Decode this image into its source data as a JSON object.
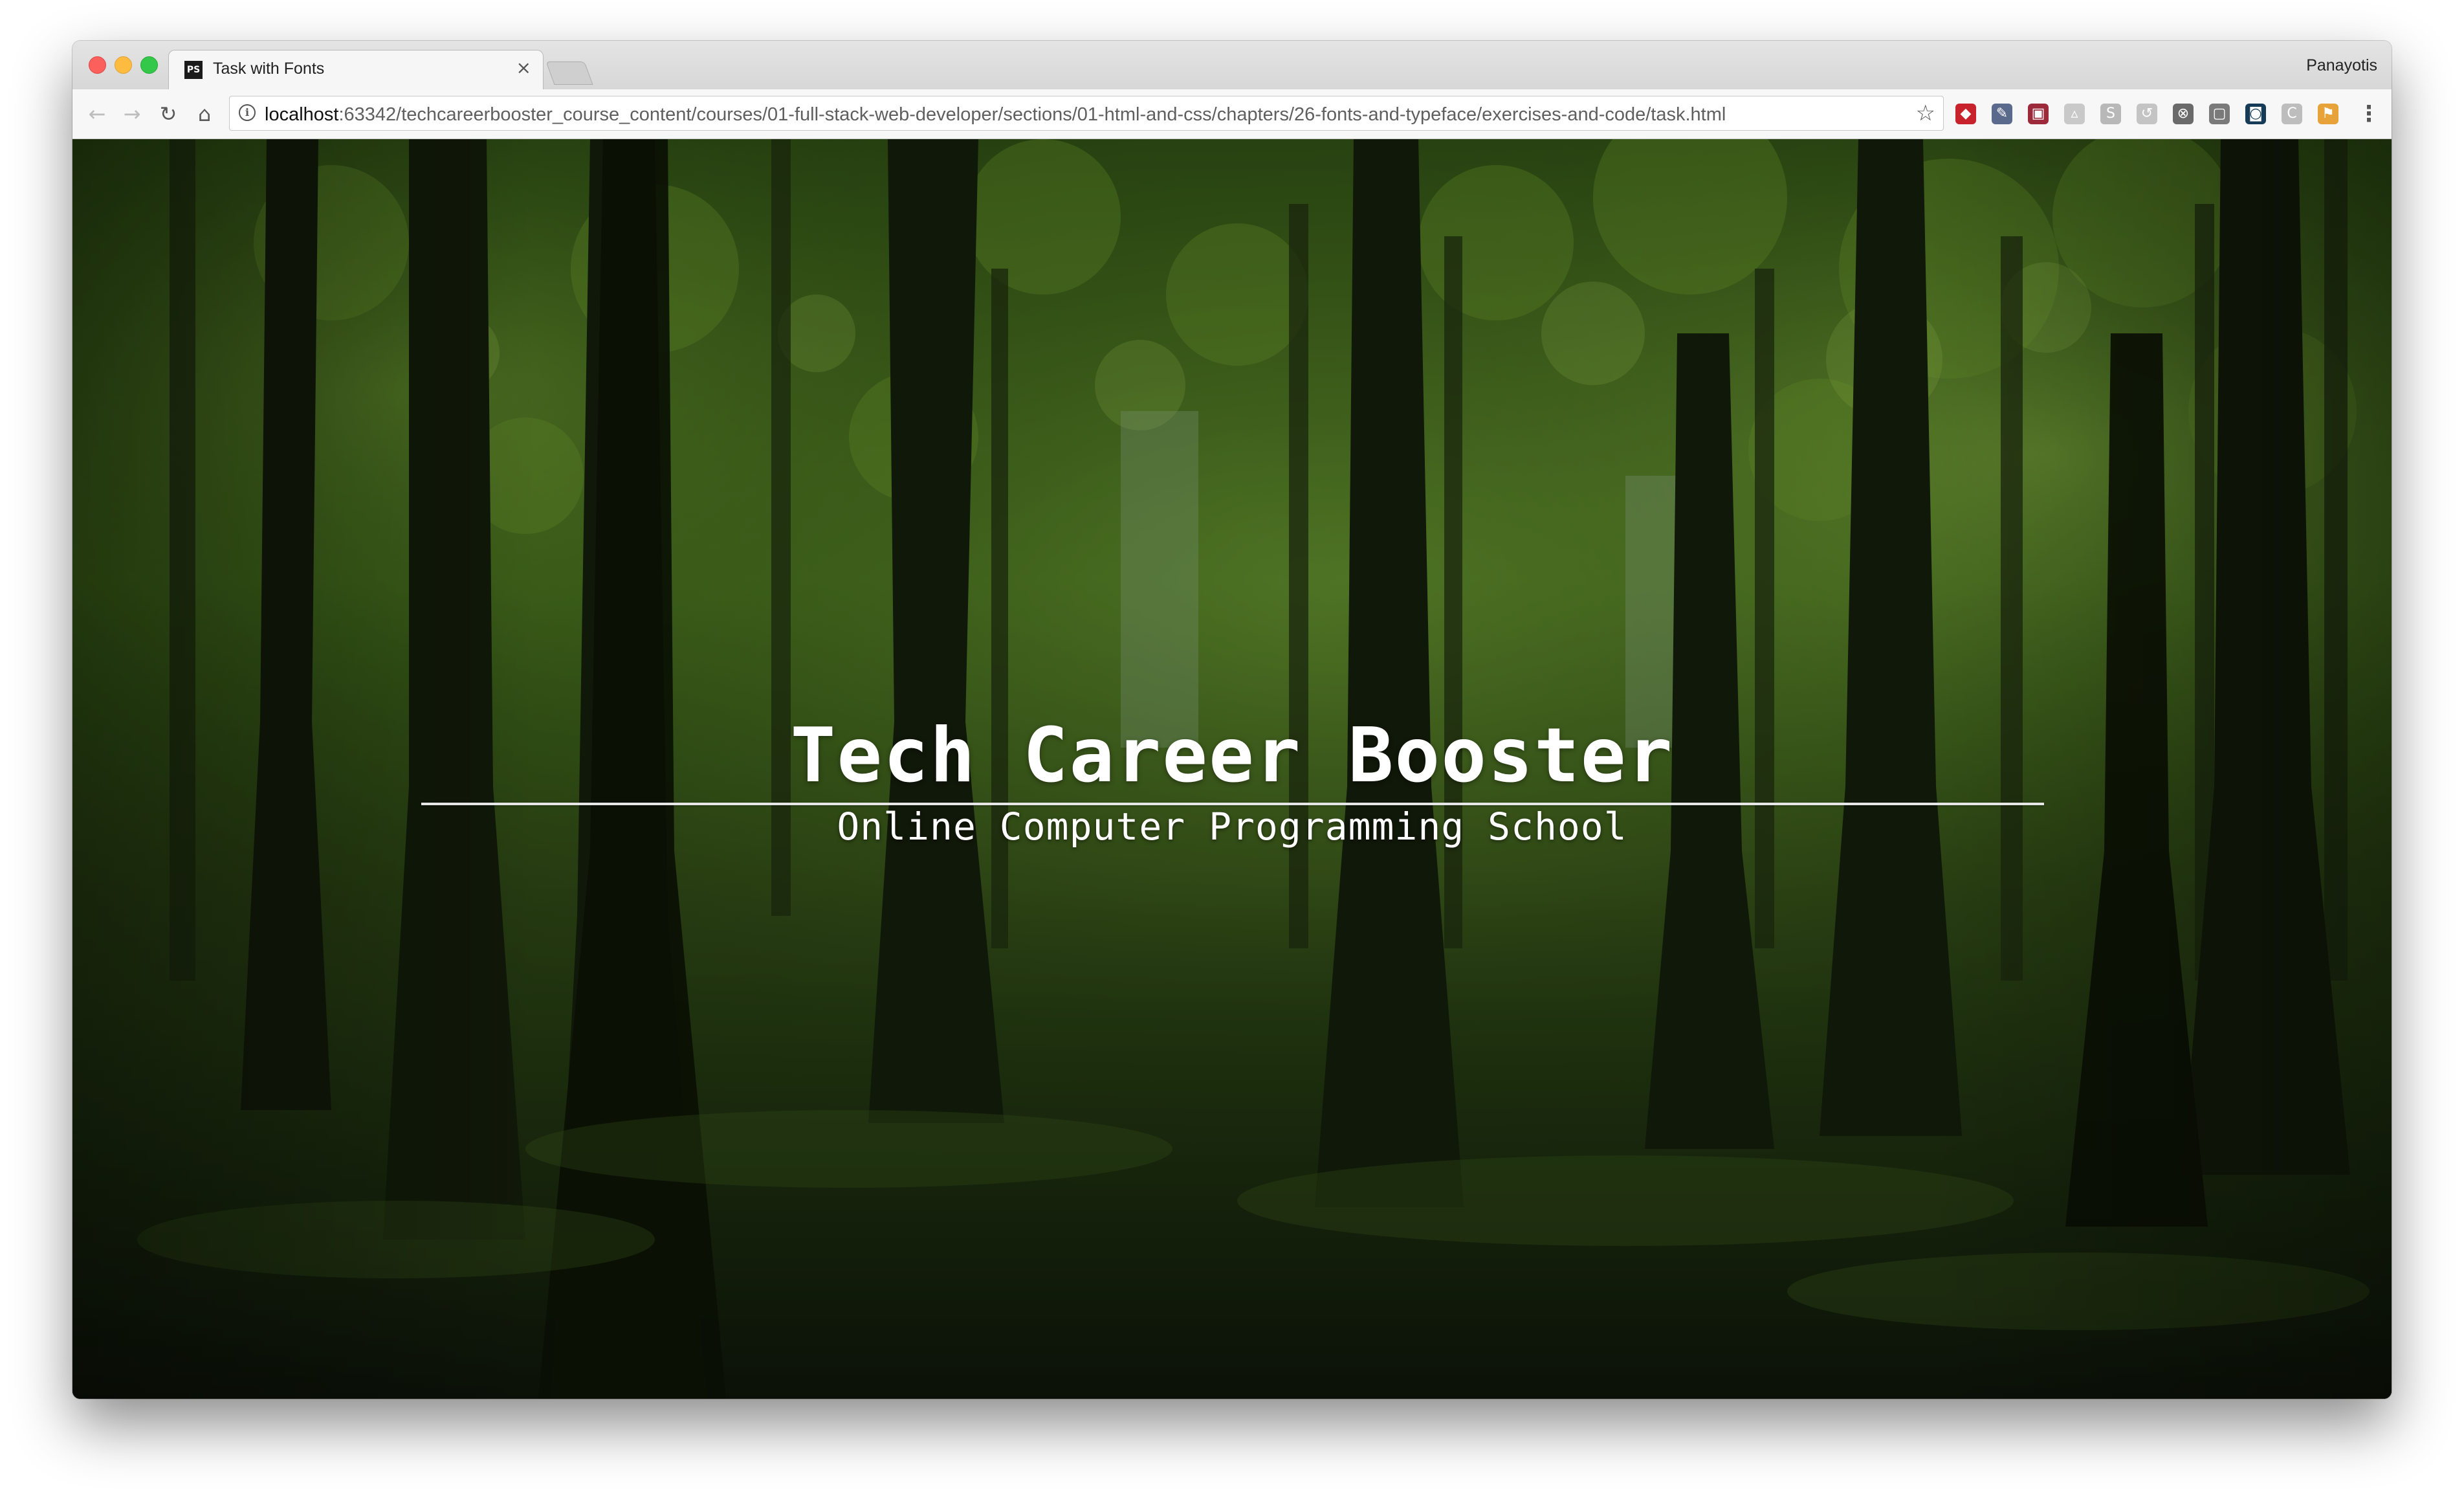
{
  "window": {
    "profile_name": "Panayotis"
  },
  "tab": {
    "title": "Task with Fonts",
    "favicon_text": "PS",
    "close_glyph": "×"
  },
  "toolbar": {
    "back_icon": "←",
    "forward_icon": "→",
    "reload_icon": "↻",
    "home_icon": "⌂",
    "menu_icon": "⋮"
  },
  "omnibox": {
    "host": "localhost",
    "rest": ":63342/techcareerbooster_course_content/courses/01-full-stack-web-developer/sections/01-html-and-css/chapters/26-fonts-and-typeface/exercises-and-code/task.html",
    "info_glyph": "i",
    "star_glyph": "☆"
  },
  "extensions": [
    {
      "name": "red-extension-icon",
      "color": "#c8232c",
      "glyph": "◆"
    },
    {
      "name": "eyedropper-extension-icon",
      "color": "#5a6a8c",
      "glyph": "✎"
    },
    {
      "name": "puzzle-extension-icon",
      "color": "#9c2a3a",
      "glyph": "▣"
    },
    {
      "name": "triangle-extension-icon",
      "color": "#c9c9c9",
      "glyph": "▵"
    },
    {
      "name": "skype-extension-icon",
      "color": "#b8b8b8",
      "glyph": "S"
    },
    {
      "name": "refresh-extension-icon",
      "color": "#c4c4c4",
      "glyph": "↺"
    },
    {
      "name": "close-circle-extension-icon",
      "color": "#6a6a6a",
      "glyph": "⊗"
    },
    {
      "name": "square-extension-icon",
      "color": "#7a7a7a",
      "glyph": "▢"
    },
    {
      "name": "keyhole-extension-icon",
      "color": "#163b57",
      "glyph": "◙"
    },
    {
      "name": "c-extension-icon",
      "color": "#bdbdbd",
      "glyph": "C"
    },
    {
      "name": "flag-extension-icon",
      "color": "#e8a23a",
      "glyph": "⚑"
    }
  ],
  "hero": {
    "headline": "Tech Career Booster",
    "subline": "Online Computer Programming School"
  }
}
